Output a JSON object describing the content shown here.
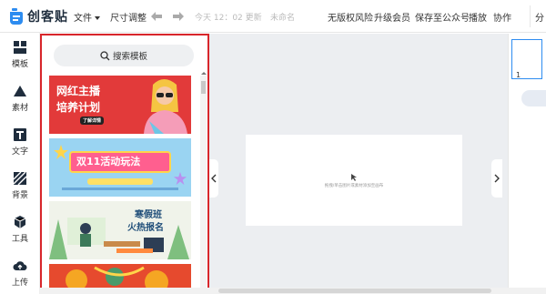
{
  "app": {
    "logo_text": "创客贴"
  },
  "toolbar": {
    "file_menu": "文件",
    "resize": "尺寸调整",
    "save_status": "今天 12：02 更新",
    "doc_title": "未命名",
    "copyright": "无版权风险",
    "upgrade": "升级会员",
    "save_to_wechat": "保存至公众号",
    "play": "播放",
    "collaborate": "协作",
    "share": "分"
  },
  "sidebar": {
    "items": [
      {
        "label": "模板",
        "icon": "template-icon"
      },
      {
        "label": "素材",
        "icon": "shapes-icon"
      },
      {
        "label": "文字",
        "icon": "text-icon"
      },
      {
        "label": "背景",
        "icon": "background-icon"
      },
      {
        "label": "工具",
        "icon": "tools-icon"
      },
      {
        "label": "上传",
        "icon": "upload-icon"
      }
    ]
  },
  "template_panel": {
    "search_label": "搜索模板",
    "cards": [
      {
        "line1": "网红主播",
        "line2": "培养计划",
        "tag": "了解详情",
        "bg": "#e23a3a"
      },
      {
        "line1": "双11活动玩法",
        "bg": "#9ad4f2"
      },
      {
        "line1": "寒假班",
        "line2": "火热报名",
        "bg": "#f0f3ea"
      },
      {
        "bg": "#e64a2e"
      }
    ]
  },
  "canvas": {
    "hint": "拖拽/单击图片或素材添加至画布"
  },
  "pages": {
    "current": "1"
  },
  "colors": {
    "accent": "#2d8cf0",
    "panel_border": "#d8262b"
  }
}
